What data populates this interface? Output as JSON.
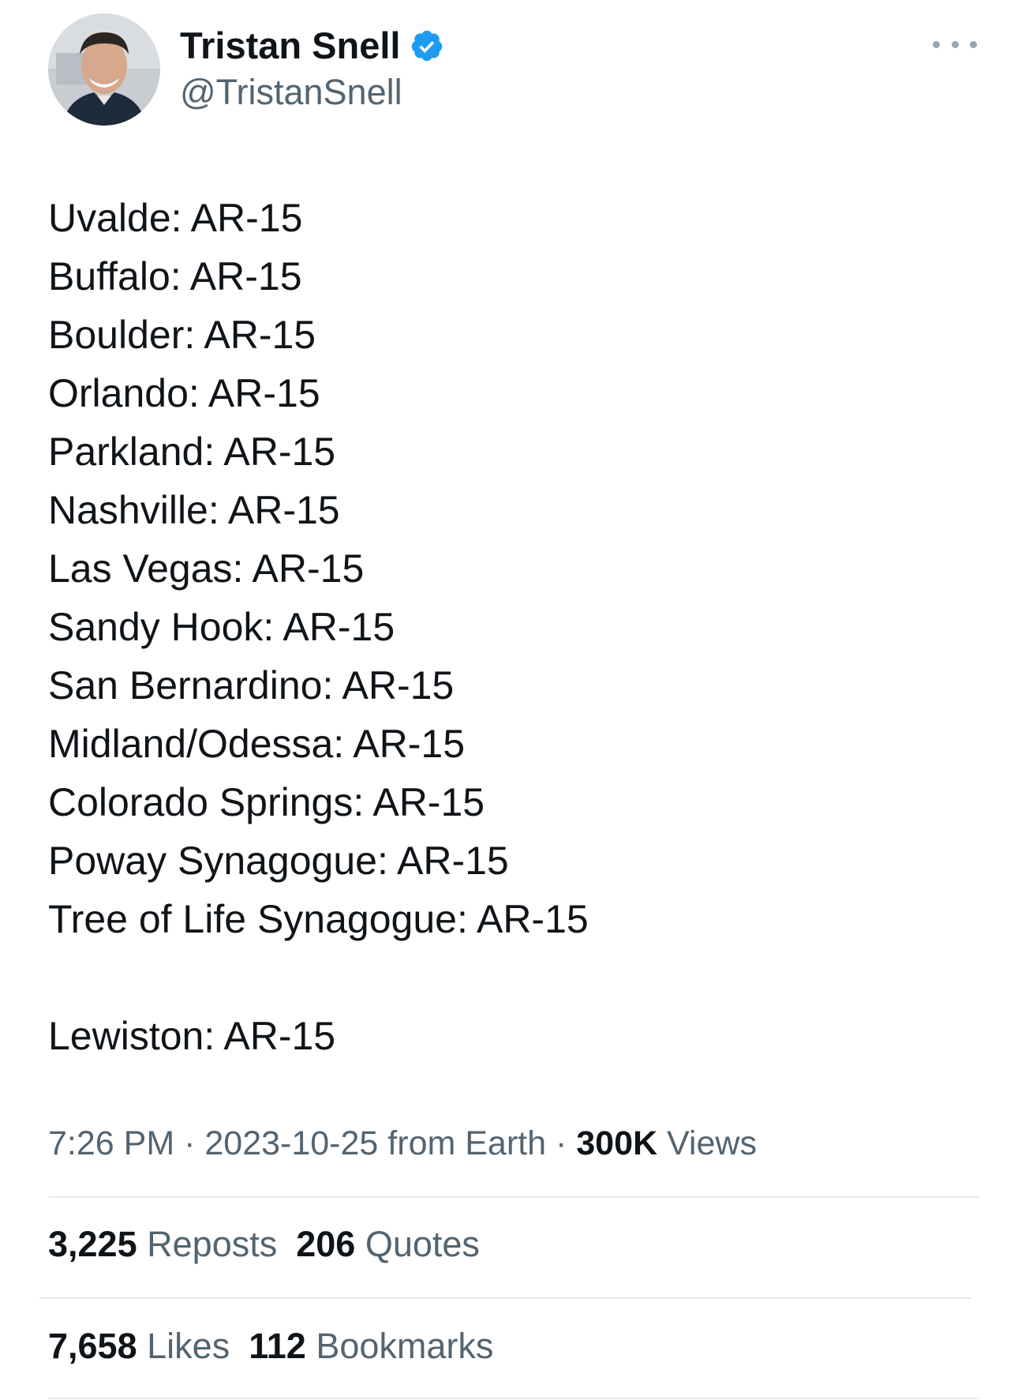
{
  "author": {
    "name": "Tristan Snell",
    "handle": "@TristanSnell",
    "verified_color": "#1d9bf0"
  },
  "tweet": {
    "lines": [
      "Uvalde: AR-15",
      "Buffalo: AR-15",
      "Boulder: AR-15",
      "Orlando: AR-15",
      "Parkland: AR-15",
      "Nashville: AR-15",
      "Las Vegas: AR-15",
      "Sandy Hook: AR-15",
      "San Bernardino: AR-15",
      "Midland/Odessa: AR-15",
      "Colorado Springs: AR-15",
      "Poway Synagogue: AR-15",
      "Tree of Life Synagogue: AR-15"
    ],
    "final_line": "Lewiston: AR-15"
  },
  "meta": {
    "time": "7:26 PM",
    "separator": "·",
    "date": "2023-10-25",
    "source": "from Earth",
    "views_count": "300K",
    "views_label": "Views"
  },
  "stats": {
    "reposts": {
      "count": "3,225",
      "label": "Reposts"
    },
    "quotes": {
      "count": "206",
      "label": "Quotes"
    },
    "likes": {
      "count": "7,658",
      "label": "Likes"
    },
    "bookmarks": {
      "count": "112",
      "label": "Bookmarks"
    }
  },
  "icons": {
    "more": "more-horizontal-icon",
    "verified": "verified-badge-icon"
  },
  "colors": {
    "text_primary": "#0f1419",
    "text_secondary": "#536471",
    "divider": "#e6e9ec"
  }
}
